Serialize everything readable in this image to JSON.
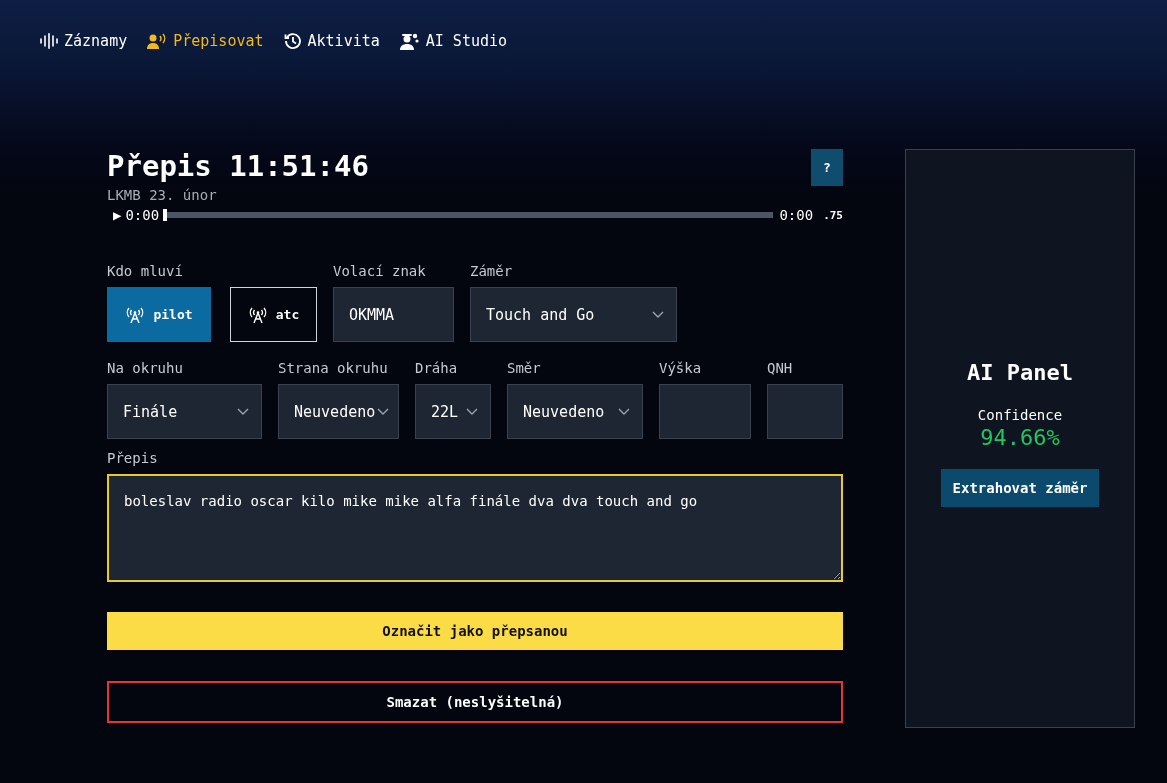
{
  "nav": [
    {
      "label": "Záznamy",
      "selected": false
    },
    {
      "label": "Přepisovat",
      "selected": true
    },
    {
      "label": "Aktivita",
      "selected": false
    },
    {
      "label": "AI Studio",
      "selected": false
    }
  ],
  "transcript": {
    "title": "Přepis 11:51:46",
    "subtitle": "LKMB 23. únor",
    "help": "?",
    "player": {
      "play": "▶",
      "current": "0:00",
      "duration": "0:00",
      "speed": ".75",
      "level": 0
    },
    "speaker": {
      "label": "Kdo mluví",
      "options": [
        {
          "label": "pilot",
          "selected": true
        },
        {
          "label": "atc",
          "selected": false
        }
      ]
    },
    "row1": [
      {
        "kind": "text",
        "label": "Volací znak",
        "value": "OKMMA"
      },
      {
        "kind": "select",
        "label": "Záměr",
        "value": "Touch and Go"
      }
    ],
    "row2": [
      {
        "kind": "select",
        "label": "Na okruhu",
        "value": "Finále"
      },
      {
        "kind": "select",
        "label": "Strana okruhu",
        "value": "Neuvedeno"
      },
      {
        "kind": "select",
        "label": "Dráha",
        "value": "22L"
      },
      {
        "kind": "select",
        "label": "Směr",
        "value": "Neuvedeno"
      },
      {
        "kind": "text",
        "label": "Výška"
      },
      {
        "kind": "text",
        "label": "QNH"
      }
    ],
    "text_label": "Přepis",
    "text": "boleslav radio oscar kilo mike mike alfa finále dva dva touch and go",
    "mark_button": "Označit jako přepsanou",
    "delete_button": "Smazat (neslyšitelná)"
  },
  "ai_panel": {
    "title": "AI Panel",
    "confidence_label": "Confidence",
    "confidence": "94.66%",
    "extract_button": "Extrahovat záměr"
  }
}
